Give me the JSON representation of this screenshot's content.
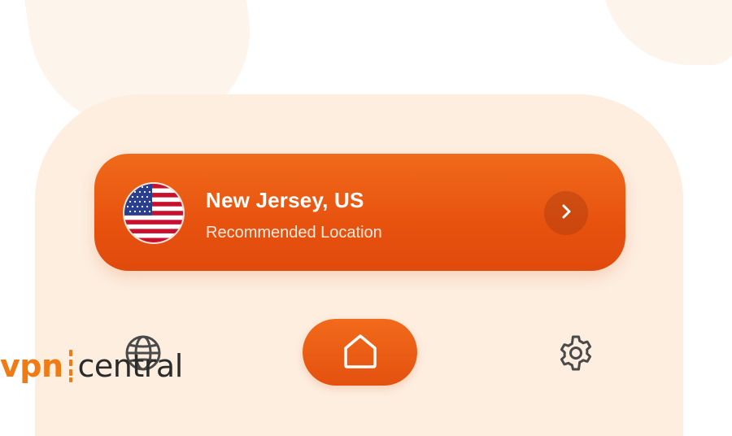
{
  "theme": {
    "accent": "#ee6418",
    "panel_bg": "#fdeee0",
    "icon_color": "#4a4a4a"
  },
  "location_card": {
    "flag_icon": "us-flag-icon",
    "title": "New Jersey, US",
    "subtitle": "Recommended Location",
    "action_icon": "chevron-right-icon"
  },
  "bottom_nav": {
    "items": [
      {
        "icon": "globe-icon"
      },
      {
        "icon": "home-icon",
        "active": true
      },
      {
        "icon": "gear-icon"
      }
    ]
  },
  "watermark": {
    "part1": "vpn",
    "part2": "central"
  }
}
